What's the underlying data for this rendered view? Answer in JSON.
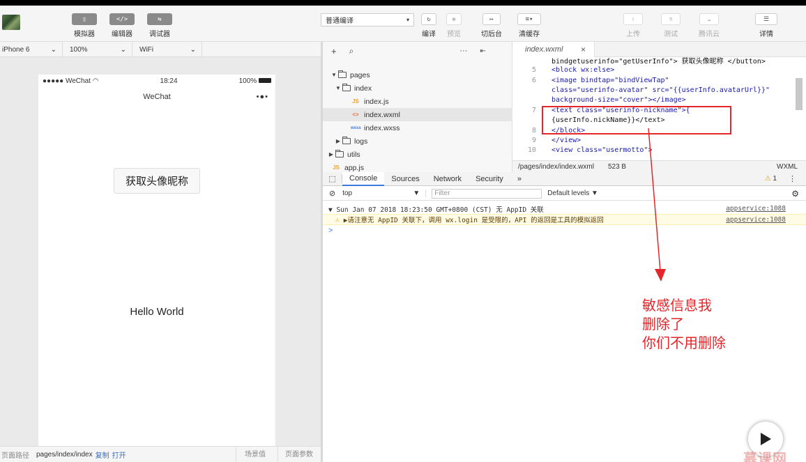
{
  "toolbar": {
    "buttons": [
      {
        "icon": "phone-icon",
        "label": "模拟器"
      },
      {
        "icon": "code-icon",
        "label": "编辑器"
      },
      {
        "icon": "debug-icon",
        "label": "调试器"
      }
    ],
    "compile_mode": "普通编译",
    "actions": {
      "compile": "编译",
      "preview": "预览",
      "background": "切后台",
      "clear_cache": "清缓存",
      "upload": "上传",
      "test": "测试",
      "tencent_cloud": "腾讯云",
      "details": "详情"
    }
  },
  "device_bar": {
    "device": "iPhone 6",
    "zoom": "100%",
    "network": "WiFi"
  },
  "phone": {
    "carrier": "●●●●● WeChat",
    "time": "18:24",
    "battery": "100%",
    "nav_title": "WeChat",
    "nav_dots": "•●•",
    "avatar_button": "获取头像昵称",
    "hello_text": "Hello World"
  },
  "bottom_bar": {
    "path_label": "页面路径",
    "path_value": "pages/index/index",
    "copy": "复制",
    "open": "打开",
    "scene": "场景值",
    "params": "页面参数"
  },
  "file_tree": [
    {
      "name": "pages",
      "type": "folder",
      "open": true
    },
    {
      "name": "index",
      "type": "folder",
      "open": true
    },
    {
      "name": "index.js",
      "type": "js"
    },
    {
      "name": "index.wxml",
      "type": "wxml"
    },
    {
      "name": "index.wxss",
      "type": "wxss"
    },
    {
      "name": "logs",
      "type": "folder",
      "open": false
    },
    {
      "name": "utils",
      "type": "folder",
      "open": false
    },
    {
      "name": "app.js",
      "type": "js"
    }
  ],
  "editor": {
    "tab": "index.wxml",
    "code_lines": [
      {
        "n": "",
        "text": "bindgetuserinfo=\"getUserInfo\"> 获取头像昵称 </button>"
      },
      {
        "n": "5",
        "text": "  <block wx:else>"
      },
      {
        "n": "6",
        "text": "    <image bindtap=\"bindViewTap\""
      },
      {
        "n": "",
        "text": "class=\"userinfo-avatar\" src=\"{{userInfo.avatarUrl}}\""
      },
      {
        "n": "",
        "text": "background-size=\"cover\"></image>"
      },
      {
        "n": "7",
        "text": "    <text class=\"userinfo-nickname\">{"
      },
      {
        "n": "",
        "text": "{userInfo.nickName}}</text>"
      },
      {
        "n": "8",
        "text": "  </block>"
      },
      {
        "n": "9",
        "text": "</view>"
      },
      {
        "n": "10",
        "text": "<view class=\"usermotto\">"
      }
    ],
    "footer_path": "/pages/index/index.wxml",
    "footer_size": "523 B",
    "footer_lang": "WXML"
  },
  "devtools": {
    "tabs": [
      "Console",
      "Sources",
      "Network",
      "Security"
    ],
    "more": "»",
    "warning_count": "1",
    "context": "top",
    "filter_placeholder": "Filter",
    "levels": "Default levels ▼",
    "log_group": "▼ Sun Jan 07 2018 18:23:50 GMT+0800 (CST) 无 AppID 关联",
    "log_group_source": "appservice:1088",
    "log_warning": "▶请注意无 AppID 关联下，调用 wx.login 是受限的，API 的返回是工具的模拟返回",
    "log_warning_source": "appservice:1088",
    "prompt": ">"
  },
  "annotation": {
    "line1": "敏感信息我",
    "line2": "删除了",
    "line3": "你们不用删除",
    "color": "#e4252a"
  },
  "watermark": "慕课网"
}
